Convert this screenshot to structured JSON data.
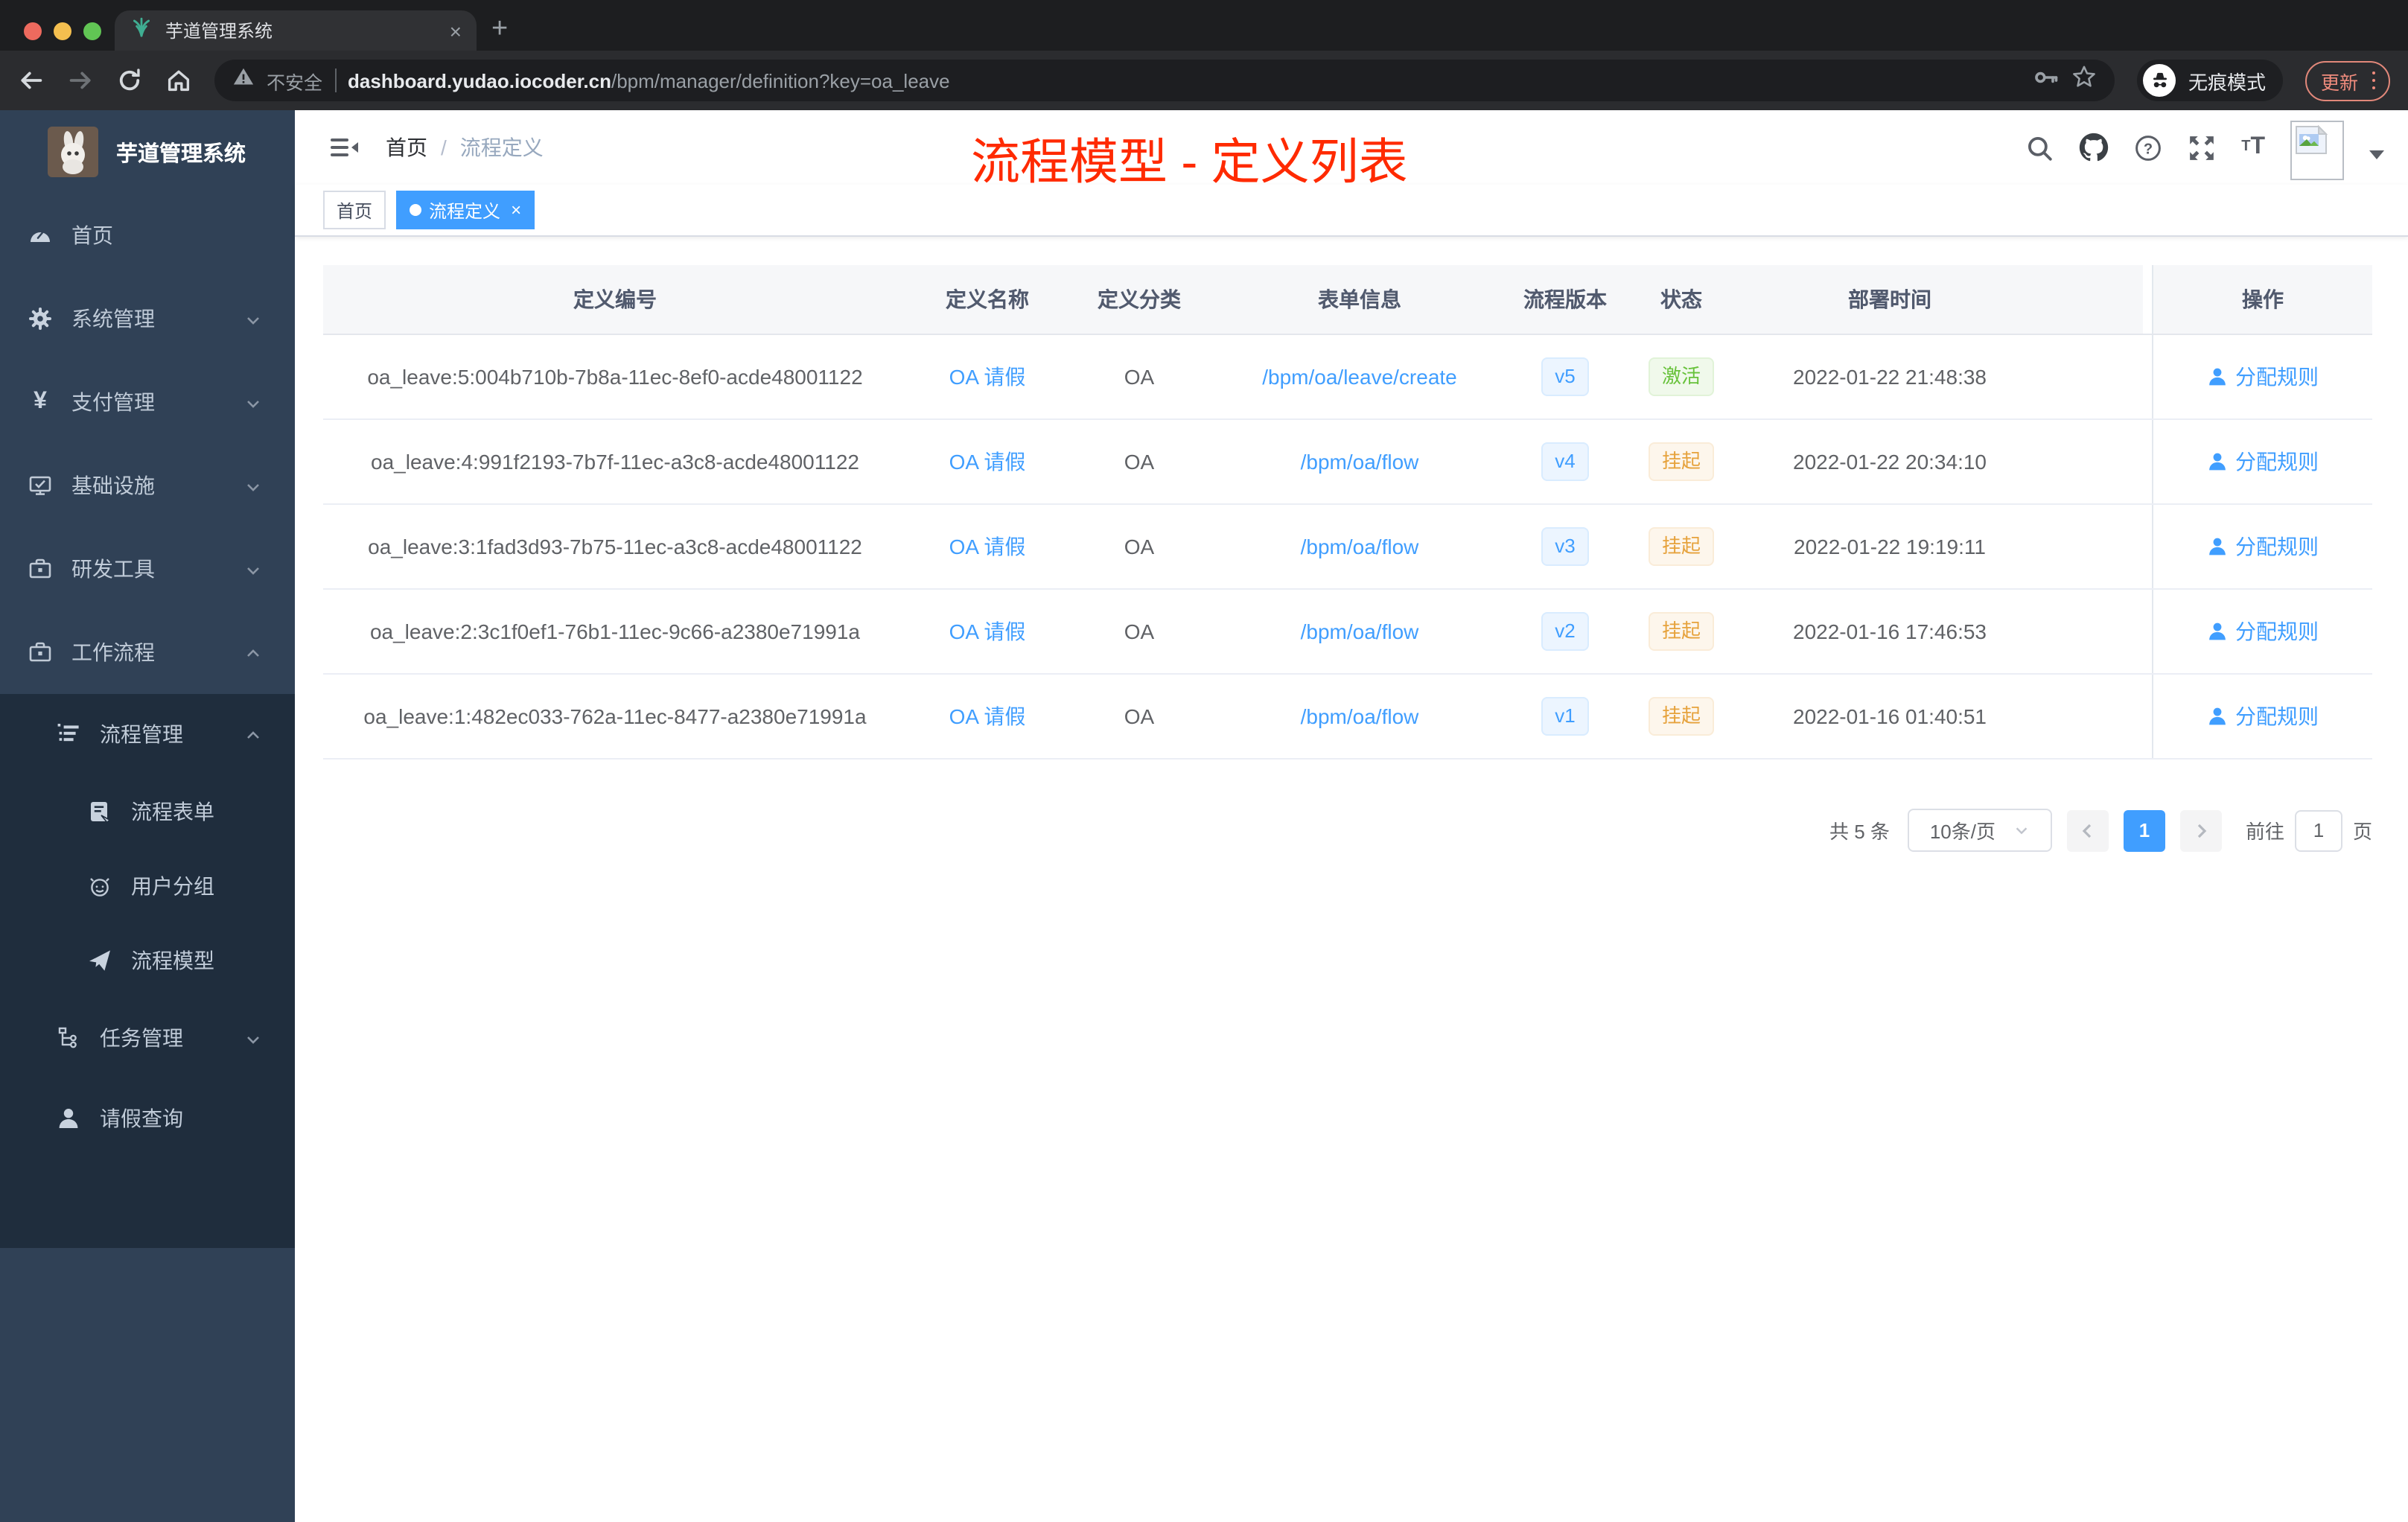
{
  "colors": {
    "accent": "#409eff",
    "overlay_title_red": "#ff2a00",
    "status_active_green": "#67c23a",
    "status_suspended_orange": "#e6a23c",
    "sidebar_bg": "#304156",
    "sidebar_sub_bg": "#1f2d3d"
  },
  "browser": {
    "tab_title": "芋道管理系统",
    "tab_close": "×",
    "new_tab": "+",
    "security_label": "不安全",
    "url_host": "dashboard.yudao.iocoder.cn",
    "url_path": "/bpm/manager/definition?key=oa_leave",
    "incognito_label": "无痕模式",
    "update_label": "更新"
  },
  "sidebar": {
    "logo_title": "芋道管理系统",
    "items": [
      {
        "label": "首页"
      },
      {
        "label": "系统管理"
      },
      {
        "label": "支付管理"
      },
      {
        "label": "基础设施"
      },
      {
        "label": "研发工具"
      },
      {
        "label": "工作流程"
      },
      {
        "label": "流程管理"
      },
      {
        "label": "流程表单"
      },
      {
        "label": "用户分组"
      },
      {
        "label": "流程模型"
      },
      {
        "label": "任务管理"
      },
      {
        "label": "请假查询"
      }
    ]
  },
  "navbar": {
    "breadcrumb_home": "首页",
    "breadcrumb_sep": "/",
    "breadcrumb_current": "流程定义",
    "overlay_title": "流程模型 - 定义列表",
    "help_glyph": "?"
  },
  "tags": {
    "home": "首页",
    "active": "流程定义",
    "active_close": "×"
  },
  "table": {
    "headers": {
      "id": "定义编号",
      "name": "定义名称",
      "category": "定义分类",
      "form": "表单信息",
      "version": "流程版本",
      "status": "状态",
      "deploy_time": "部署时间",
      "actions": "操作"
    },
    "action_label": "分配规则",
    "rows": [
      {
        "id": "oa_leave:5:004b710b-7b8a-11ec-8ef0-acde48001122",
        "name": "OA 请假",
        "category": "OA",
        "form": "/bpm/oa/leave/create",
        "version": "v5",
        "status": "激活",
        "deploy_time": "2022-01-22 21:48:38"
      },
      {
        "id": "oa_leave:4:991f2193-7b7f-11ec-a3c8-acde48001122",
        "name": "OA 请假",
        "category": "OA",
        "form": "/bpm/oa/flow",
        "version": "v4",
        "status": "挂起",
        "deploy_time": "2022-01-22 20:34:10"
      },
      {
        "id": "oa_leave:3:1fad3d93-7b75-11ec-a3c8-acde48001122",
        "name": "OA 请假",
        "category": "OA",
        "form": "/bpm/oa/flow",
        "version": "v3",
        "status": "挂起",
        "deploy_time": "2022-01-22 19:19:11"
      },
      {
        "id": "oa_leave:2:3c1f0ef1-76b1-11ec-9c66-a2380e71991a",
        "name": "OA 请假",
        "category": "OA",
        "form": "/bpm/oa/flow",
        "version": "v2",
        "status": "挂起",
        "deploy_time": "2022-01-16 17:46:53"
      },
      {
        "id": "oa_leave:1:482ec033-762a-11ec-8477-a2380e71991a",
        "name": "OA 请假",
        "category": "OA",
        "form": "/bpm/oa/flow",
        "version": "v1",
        "status": "挂起",
        "deploy_time": "2022-01-16 01:40:51"
      }
    ]
  },
  "pagination": {
    "total": "共 5 条",
    "page_size": "10条/页",
    "page": "1",
    "goto_label": "前往",
    "goto_value": "1",
    "unit": "页"
  }
}
